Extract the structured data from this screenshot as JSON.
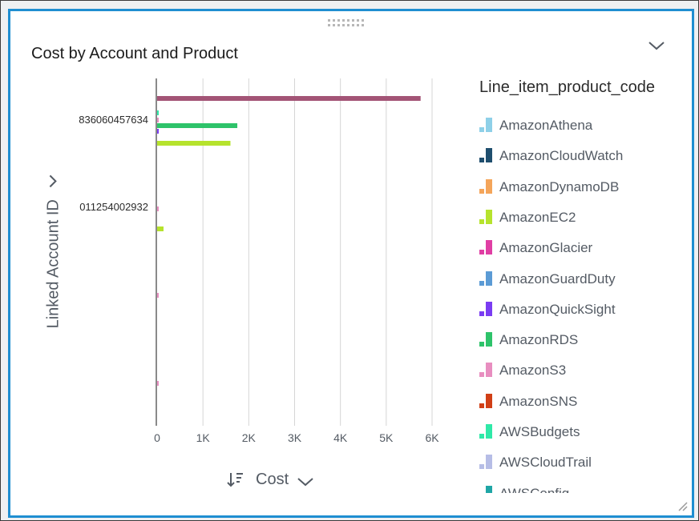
{
  "visual": {
    "title": "Cost by Account and Product",
    "y_axis_title": "Linked Account ID",
    "x_field_label": "Cost",
    "legend_title": "Line_item_product_code"
  },
  "legend_items": [
    {
      "label": "AmazonAthena",
      "color": "#8ed0e8"
    },
    {
      "label": "AmazonCloudWatch",
      "color": "#1f4e6e"
    },
    {
      "label": "AmazonDynamoDB",
      "color": "#f4a55a"
    },
    {
      "label": "AmazonEC2",
      "color": "#b6e32d"
    },
    {
      "label": "AmazonGlacier",
      "color": "#e03ea4"
    },
    {
      "label": "AmazonGuardDuty",
      "color": "#5b9bd5"
    },
    {
      "label": "AmazonQuickSight",
      "color": "#7a3cf2"
    },
    {
      "label": "AmazonRDS",
      "color": "#2ec36a"
    },
    {
      "label": "AmazonS3",
      "color": "#e88ec0"
    },
    {
      "label": "AmazonSNS",
      "color": "#d13f16"
    },
    {
      "label": "AWSBudgets",
      "color": "#2fe9a8"
    },
    {
      "label": "AWSCloudTrail",
      "color": "#b6bde6"
    },
    {
      "label": "AWSConfig",
      "color": "#1fa6a6"
    }
  ],
  "chart_data": {
    "type": "bar",
    "orientation": "horizontal",
    "title": "Cost by Account and Product",
    "xlabel": "Cost",
    "ylabel": "Linked Account ID",
    "xlim": [
      0,
      6000
    ],
    "xticks": [
      "0",
      "1K",
      "2K",
      "3K",
      "4K",
      "5K",
      "6K"
    ],
    "grid": true,
    "legend_position": "right",
    "categories": [
      "836060457634",
      "011254002932",
      "",
      ""
    ],
    "bars": [
      {
        "category_index": 0,
        "product": "AmazonGlacier",
        "value": 5750,
        "color": "#a35476"
      },
      {
        "category_index": 0,
        "product": "AWSBudgets",
        "value": 15,
        "color": "#2fe9a8"
      },
      {
        "category_index": 0,
        "product": "AmazonS3",
        "value": 10,
        "color": "#e88ec0"
      },
      {
        "category_index": 0,
        "product": "AmazonRDS",
        "value": 1750,
        "color": "#2ec36a"
      },
      {
        "category_index": 0,
        "product": "AmazonQuickSight",
        "value": 20,
        "color": "#7a3cf2"
      },
      {
        "category_index": 0,
        "product": "AmazonEC2",
        "value": 1600,
        "color": "#b6e32d"
      },
      {
        "category_index": 1,
        "product": "AmazonS3",
        "value": 25,
        "color": "#e88ec0"
      },
      {
        "category_index": 1,
        "product": "AmazonEC2",
        "value": 140,
        "color": "#b6e32d"
      },
      {
        "category_index": 2,
        "product": "AmazonS3",
        "value": 20,
        "color": "#e88ec0"
      },
      {
        "category_index": 3,
        "product": "AmazonS3",
        "value": 20,
        "color": "#e88ec0"
      }
    ]
  }
}
